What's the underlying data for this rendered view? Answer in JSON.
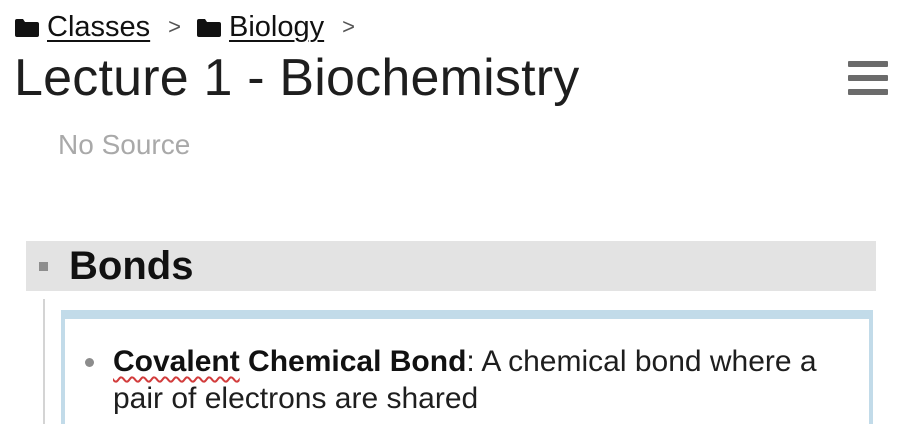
{
  "breadcrumb": {
    "items": [
      {
        "label": "Classes",
        "icon": "folder-icon"
      },
      {
        "label": "Biology",
        "icon": "folder-icon"
      }
    ],
    "separator": ">"
  },
  "page": {
    "title": "Lecture 1 -  Biochemistry",
    "source": "No Source",
    "menu_icon": "hamburger-menu-icon"
  },
  "section": {
    "title": "Bonds"
  },
  "note": {
    "term_part1": "Covalent",
    "term_part2": " Chemical Bond",
    "definition": ": A chemical bond where a pair of electrons are shared"
  },
  "colors": {
    "section_header_bg": "#e3e3e3",
    "card_border": "#c2dbe9",
    "placeholder_text": "#a9a9a9",
    "spellcheck_underline": "#d23c3c"
  }
}
